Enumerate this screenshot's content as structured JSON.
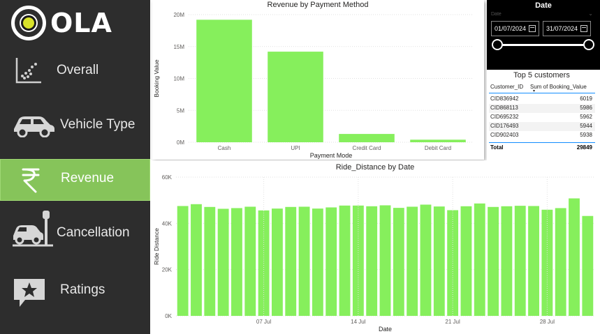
{
  "brand": {
    "name": "OLA"
  },
  "nav": {
    "items": [
      {
        "label": "Overall",
        "icon": "scatter-chart-icon",
        "active": false
      },
      {
        "label": "Vehicle Type",
        "icon": "car-icon",
        "active": false
      },
      {
        "label": "Revenue",
        "icon": "rupee-icon",
        "active": true
      },
      {
        "label": "Cancellation",
        "icon": "car-parking-icon",
        "active": false
      },
      {
        "label": "Ratings",
        "icon": "star-chat-icon",
        "active": false
      }
    ]
  },
  "colors": {
    "sidebar": "#2d2d2d",
    "active": "#86c45a",
    "bar": "#86ef5c"
  },
  "date_filter": {
    "title": "Date",
    "sub": "Date",
    "start": "01/07/2024",
    "end": "31/07/2024"
  },
  "top_customers": {
    "title": "Top 5 customers",
    "columns": [
      "Customer_ID",
      "Sum of Booking_Value"
    ],
    "rows": [
      [
        "CID836942",
        "6019"
      ],
      [
        "CID868113",
        "5986"
      ],
      [
        "CID695232",
        "5962"
      ],
      [
        "CID176493",
        "5944"
      ],
      [
        "CID902403",
        "5938"
      ]
    ],
    "total_label": "Total",
    "total_value": "29849"
  },
  "chart_data": [
    {
      "type": "bar",
      "title": "Revenue by Payment Method",
      "xlabel": "Payment Mode",
      "ylabel": "Booking Value",
      "categories": [
        "Cash",
        "UPI",
        "Credit Card",
        "Debit Card"
      ],
      "values": [
        19200000,
        14200000,
        1300000,
        400000
      ],
      "ylim": [
        0,
        20000000
      ],
      "yticks": [
        "0M",
        "5M",
        "10M",
        "15M",
        "20M"
      ],
      "ytick_values": [
        0,
        5000000,
        10000000,
        15000000,
        20000000
      ],
      "grid": true
    },
    {
      "type": "bar",
      "title": "Ride_Distance by Date",
      "xlabel": "Date",
      "ylabel": "Ride Distance",
      "x": [
        "2024-07-01",
        "2024-07-02",
        "2024-07-03",
        "2024-07-04",
        "2024-07-05",
        "2024-07-06",
        "2024-07-07",
        "2024-07-08",
        "2024-07-09",
        "2024-07-10",
        "2024-07-11",
        "2024-07-12",
        "2024-07-13",
        "2024-07-14",
        "2024-07-15",
        "2024-07-16",
        "2024-07-17",
        "2024-07-18",
        "2024-07-19",
        "2024-07-20",
        "2024-07-21",
        "2024-07-22",
        "2024-07-23",
        "2024-07-24",
        "2024-07-25",
        "2024-07-26",
        "2024-07-27",
        "2024-07-28",
        "2024-07-29",
        "2024-07-30",
        "2024-07-31"
      ],
      "values": [
        47500,
        48300,
        47100,
        46300,
        46600,
        47200,
        45600,
        46400,
        47100,
        47200,
        46400,
        46900,
        47700,
        47700,
        47400,
        47800,
        46700,
        47200,
        48100,
        47300,
        45700,
        47400,
        48600,
        47100,
        47400,
        47600,
        47500,
        45900,
        46600,
        50800,
        43200
      ],
      "ylim": [
        0,
        60000
      ],
      "yticks": [
        "0K",
        "20K",
        "40K",
        "60K"
      ],
      "ytick_values": [
        0,
        20000,
        40000,
        60000
      ],
      "xticks": [
        "07 Jul",
        "14 Jul",
        "21 Jul",
        "28 Jul"
      ],
      "xtick_index": [
        6,
        13,
        20,
        27
      ],
      "grid": true
    }
  ]
}
